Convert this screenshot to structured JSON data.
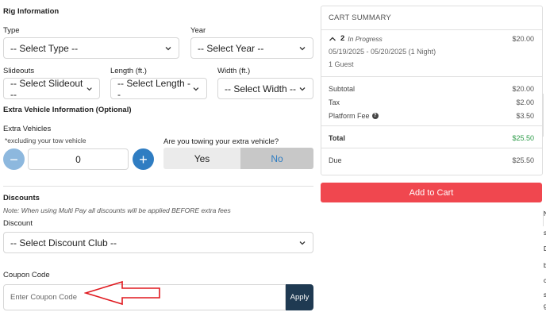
{
  "rig": {
    "section_title": "Rig Information",
    "type_label": "Type",
    "type_value": "-- Select Type --",
    "year_label": "Year",
    "year_value": "-- Select Year --",
    "slideouts_label": "Slideouts",
    "slideouts_value": "-- Select Slideout --",
    "length_label": "Length (ft.)",
    "length_value": "-- Select Length --",
    "width_label": "Width (ft.)",
    "width_value": "-- Select Width --"
  },
  "extra_vehicle": {
    "section_title": "Extra Vehicle Information (Optional)",
    "label": "Extra Vehicles",
    "sub_note": "*excluding your tow vehicle",
    "minus": "−",
    "plus": "+",
    "count": "0",
    "towing_question": "Are you towing your extra vehicle?",
    "yes": "Yes",
    "no": "No"
  },
  "discounts": {
    "section_title": "Discounts",
    "note": "Note: When using Multi Pay all discounts will be applied BEFORE extra fees",
    "discount_label": "Discount",
    "discount_value": "-- Select Discount Club --"
  },
  "coupon": {
    "label": "Coupon Code",
    "placeholder": "Enter Coupon Code",
    "apply": "Apply"
  },
  "cart": {
    "title": "CART SUMMARY",
    "item_count": "2",
    "item_status": "In Progress",
    "item_amount": "$20.00",
    "dates": "05/19/2025 - 05/20/2025 (1 Night)",
    "guests": "1 Guest",
    "subtotal_label": "Subtotal",
    "subtotal_value": "$20.00",
    "tax_label": "Tax",
    "tax_value": "$2.00",
    "fee_label": "Platform Fee",
    "fee_value": "$3.50",
    "total_label": "Total",
    "total_value": "$25.50",
    "due_label": "Due",
    "due_value": "$25.50",
    "add_to_cart": "Add to Cart"
  },
  "edge_letters": [
    "N",
    "s",
    "D",
    "b",
    "c",
    "s",
    "g"
  ],
  "colors": {
    "accent_blue": "#2f7dc2",
    "add_to_cart": "#f0474f",
    "apply_button": "#1f3a52",
    "total_green": "#2e9c4a",
    "annotation_arrow": "#e0191f"
  }
}
